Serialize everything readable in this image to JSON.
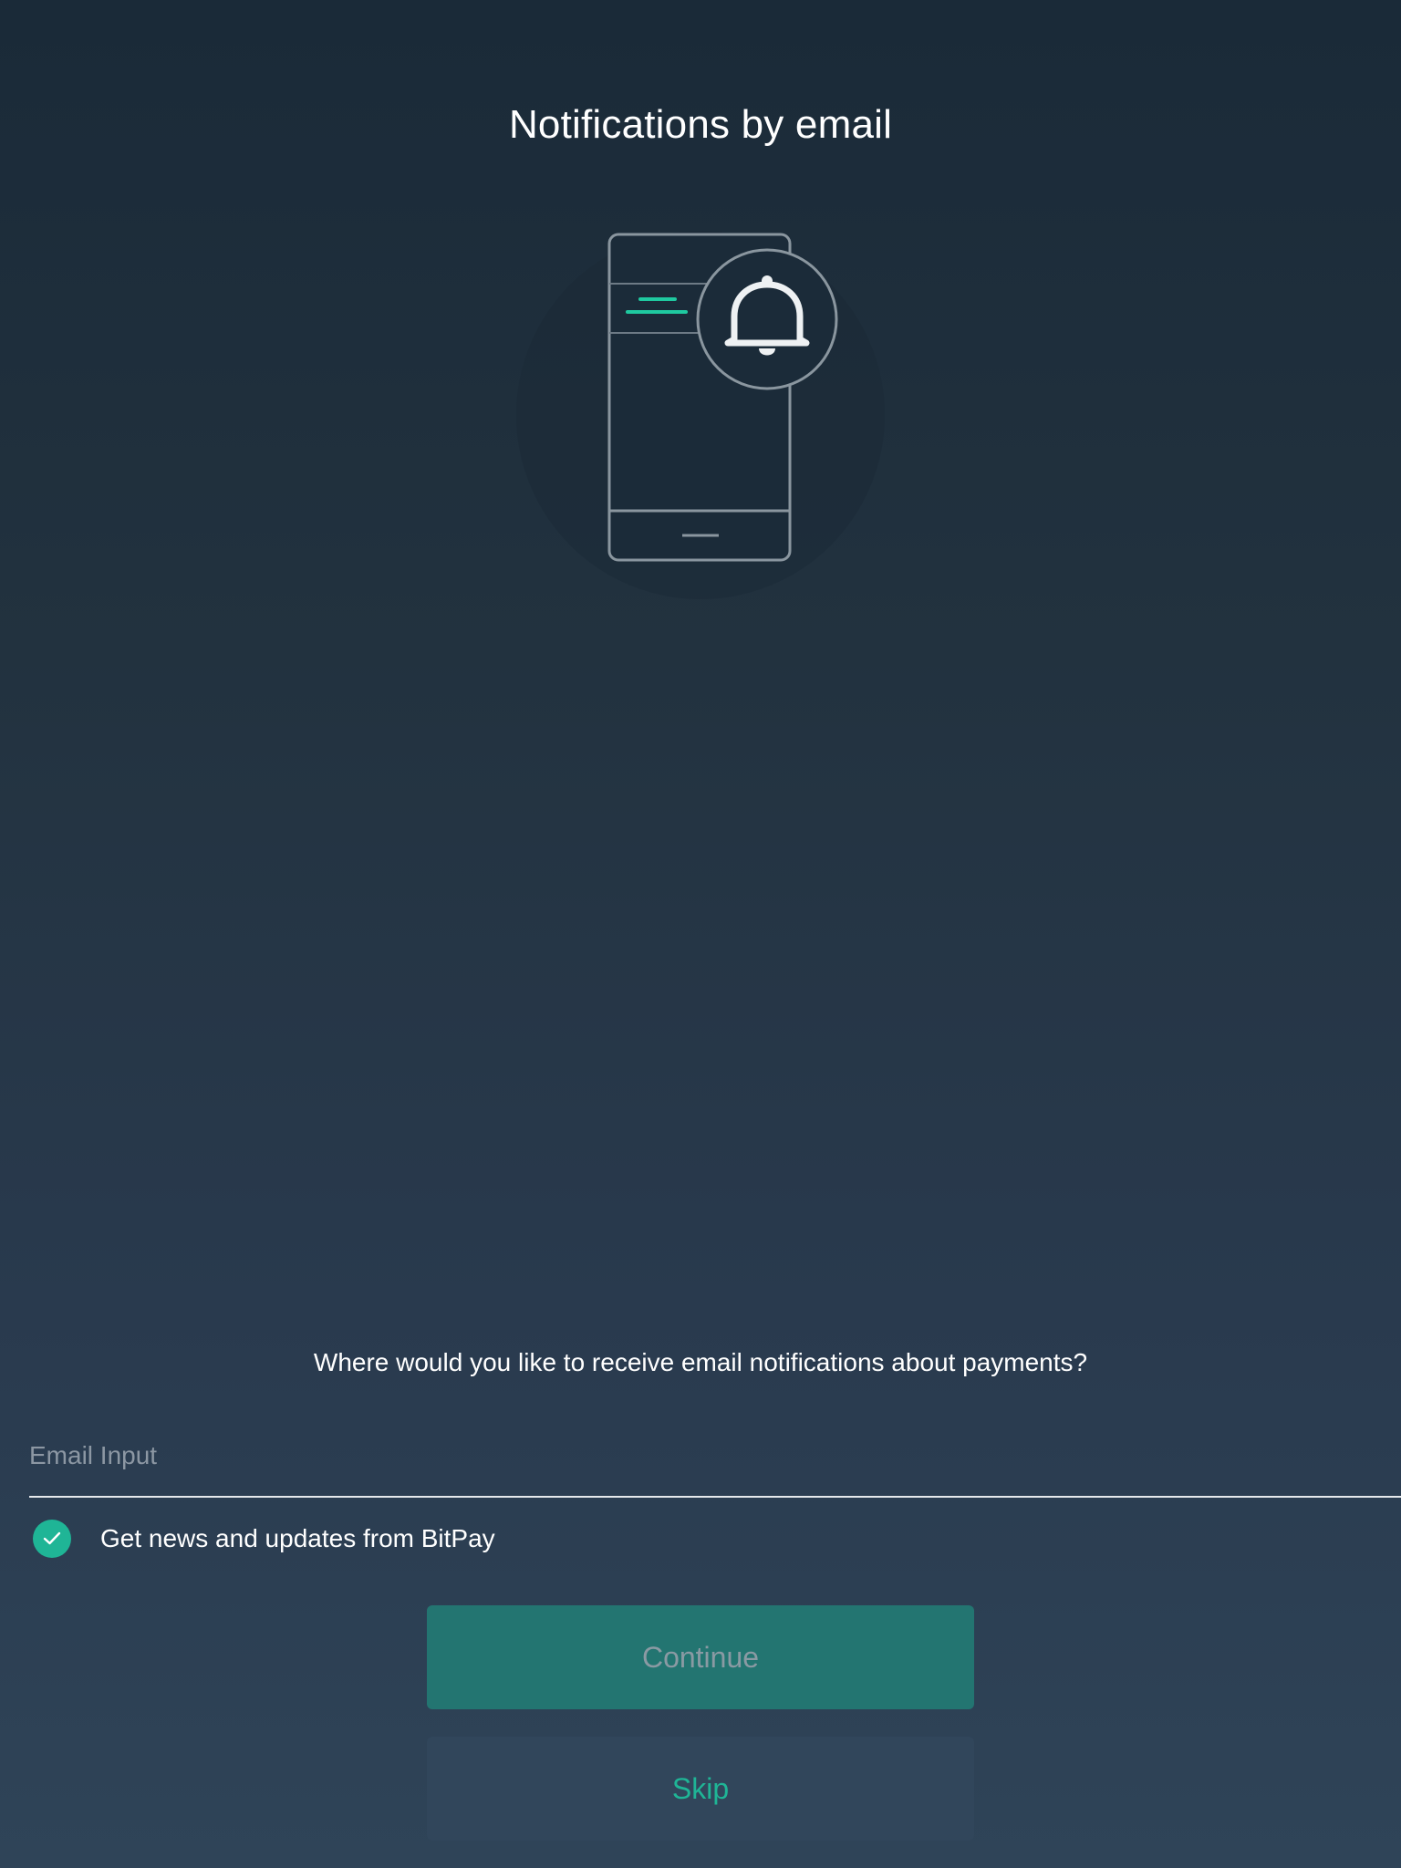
{
  "page": {
    "title": "Notifications by email",
    "prompt": "Where would you like to receive email notifications about payments?"
  },
  "email": {
    "placeholder": "Email Input",
    "value": ""
  },
  "newsletter": {
    "label": "Get news and updates from BitPay",
    "checked": true
  },
  "buttons": {
    "continue_label": "Continue",
    "skip_label": "Skip"
  },
  "colors": {
    "accent": "#1fb596",
    "continue_bg": "#237571",
    "background_top": "#1a2a38",
    "background_bottom": "#2f4458"
  },
  "icons": {
    "illustration": "phone-with-bell-icon",
    "checkbox": "checkmark-icon"
  }
}
